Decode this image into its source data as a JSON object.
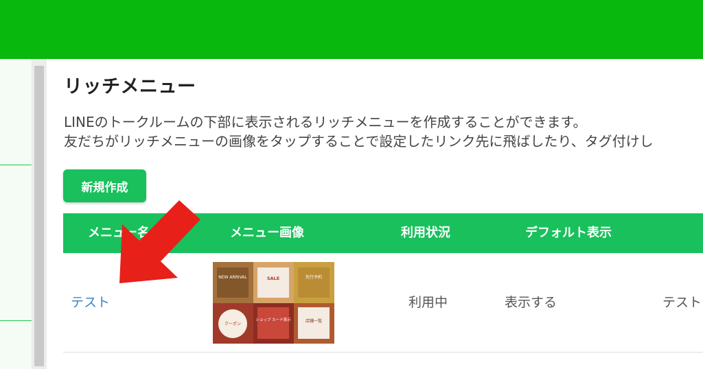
{
  "page": {
    "title": "リッチメニュー",
    "description_line1": "LINEのトークルームの下部に表示されるリッチメニューを作成することができます。",
    "description_line2": "友だちがリッチメニューの画像をタップすることで設定したリンク先に飛ばしたり、タグ付けし",
    "new_button_label": "新規作成"
  },
  "table": {
    "headers": [
      "メニュー名",
      "メニュー画像",
      "利用状況",
      "デフォルト表示"
    ],
    "rows": [
      {
        "name": "テスト",
        "status": "利用中",
        "default_display": "表示する",
        "extra": "テスト"
      }
    ]
  },
  "thumbnail": {
    "tiles": [
      "NEW ARRIVAL",
      "SALE",
      "先行予約",
      "クーポン",
      "ショップ カード表示",
      "店舗一覧"
    ]
  },
  "colors": {
    "topbar": "#08b80c",
    "accent": "#19c05c",
    "arrow": "#e8201a",
    "link": "#3b86c8"
  },
  "icons": {
    "arrow": "red-pointer-arrow"
  }
}
